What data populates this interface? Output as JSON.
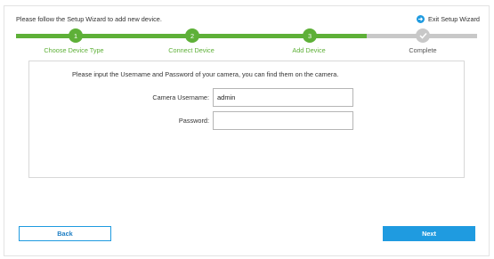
{
  "header": {
    "intro_text": "Please follow the Setup Wizard to add new device.",
    "exit_label": "Exit Setup Wizard"
  },
  "colors": {
    "done": "#5eb038",
    "pending": "#c8c8c8",
    "accent": "#1f9be0"
  },
  "steps": [
    {
      "number": "1",
      "label": "Choose Device Type",
      "status": "done"
    },
    {
      "number": "2",
      "label": "Connect Device",
      "status": "done"
    },
    {
      "number": "3",
      "label": "Add Device",
      "status": "current"
    },
    {
      "number": "",
      "label": "Complete",
      "status": "pending"
    }
  ],
  "form": {
    "instruction": "Please input the Username and Password of your camera, you can find them on the camera.",
    "username_label": "Camera Username:",
    "username_value": "admin",
    "password_label": "Password:",
    "password_value": ""
  },
  "footer": {
    "back_label": "Back",
    "next_label": "Next"
  }
}
